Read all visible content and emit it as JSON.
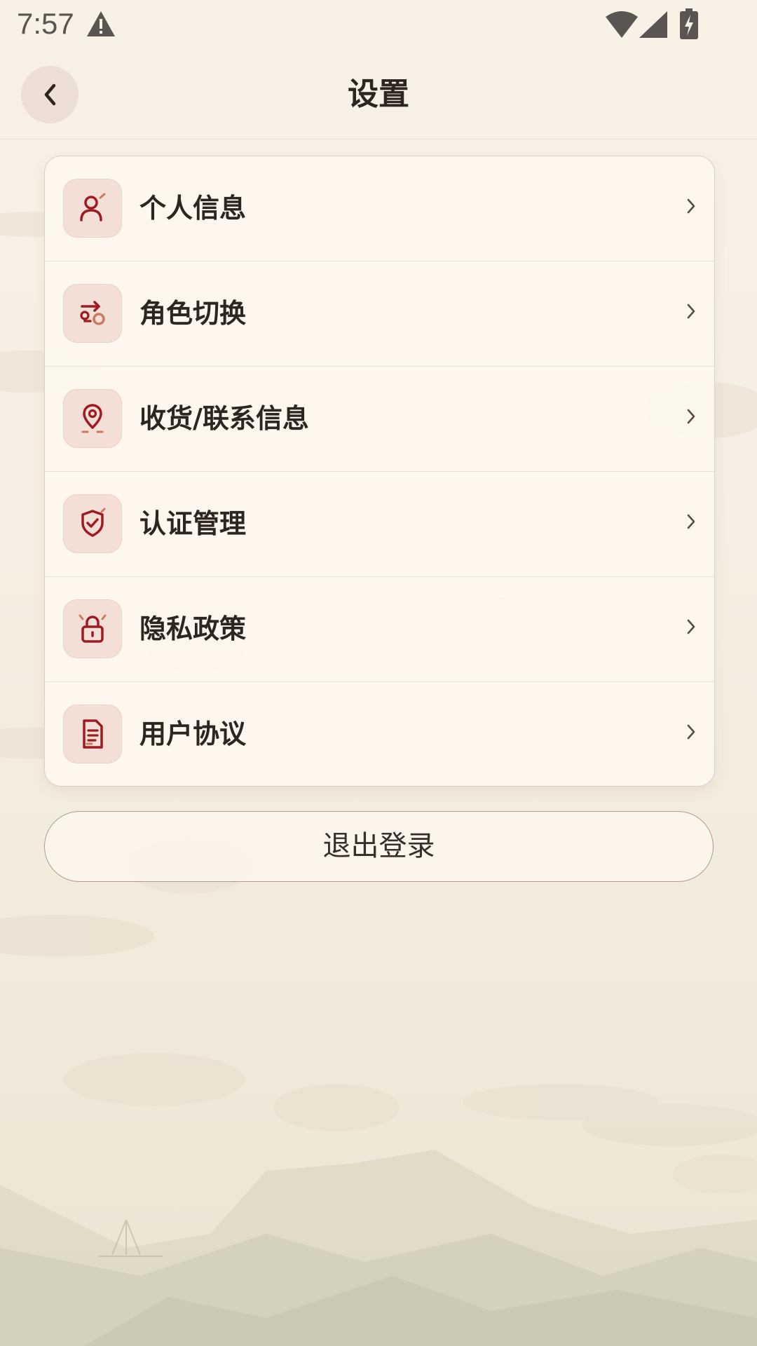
{
  "status_bar": {
    "time": "7:57",
    "warning_icon": "warning-triangle-icon",
    "wifi_icon": "wifi-icon",
    "signal_icon": "cell-signal-icon",
    "battery_icon": "battery-charging-icon"
  },
  "header": {
    "back_icon": "chevron-left-icon",
    "title": "设置"
  },
  "menu": {
    "items": [
      {
        "label": "个人信息",
        "icon": "person-icon"
      },
      {
        "label": "角色切换",
        "icon": "switch-role-icon"
      },
      {
        "label": "收货/联系信息",
        "icon": "location-pin-icon"
      },
      {
        "label": "认证管理",
        "icon": "shield-check-icon"
      },
      {
        "label": "隐私政策",
        "icon": "lock-icon"
      },
      {
        "label": "用户协议",
        "icon": "document-icon"
      }
    ],
    "chevron_icon": "chevron-right-icon"
  },
  "logout": {
    "label": "退出登录"
  },
  "colors": {
    "accent": "#9e1b22",
    "accent_light": "#c97a60",
    "icon_bg": "#f3dfd6",
    "text_primary": "#2e2420",
    "background": "#f6eee2"
  }
}
